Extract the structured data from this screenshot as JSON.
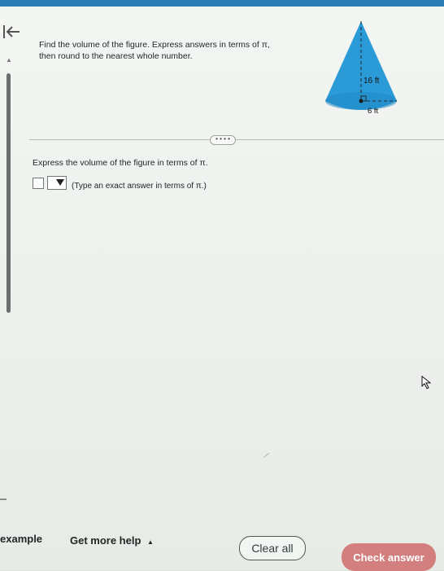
{
  "navigation": {
    "back_icon": "back-to-first-icon"
  },
  "question": {
    "text_line1": "Find the volume of the figure. Express answers in terms of π,",
    "text_line2": "then round to the nearest whole number."
  },
  "figure": {
    "height_label": "16 ft",
    "radius_label": "6 ft"
  },
  "controls": {
    "more_button_label": "• • • •"
  },
  "answer": {
    "prompt": "Express the volume of the figure in terms of π.",
    "hint": "(Type an exact answer in terms of π.)",
    "input_value": "",
    "select_value": ""
  },
  "footer": {
    "example_label": "example",
    "help_label": "Get more help",
    "help_caret": "▲",
    "clear_label": "Clear all",
    "check_label": "Check answer"
  },
  "colors": {
    "accent_blue": "#2b7fb6",
    "cone_fill": "#2b9bd8",
    "check_button": "#d37f7f"
  }
}
